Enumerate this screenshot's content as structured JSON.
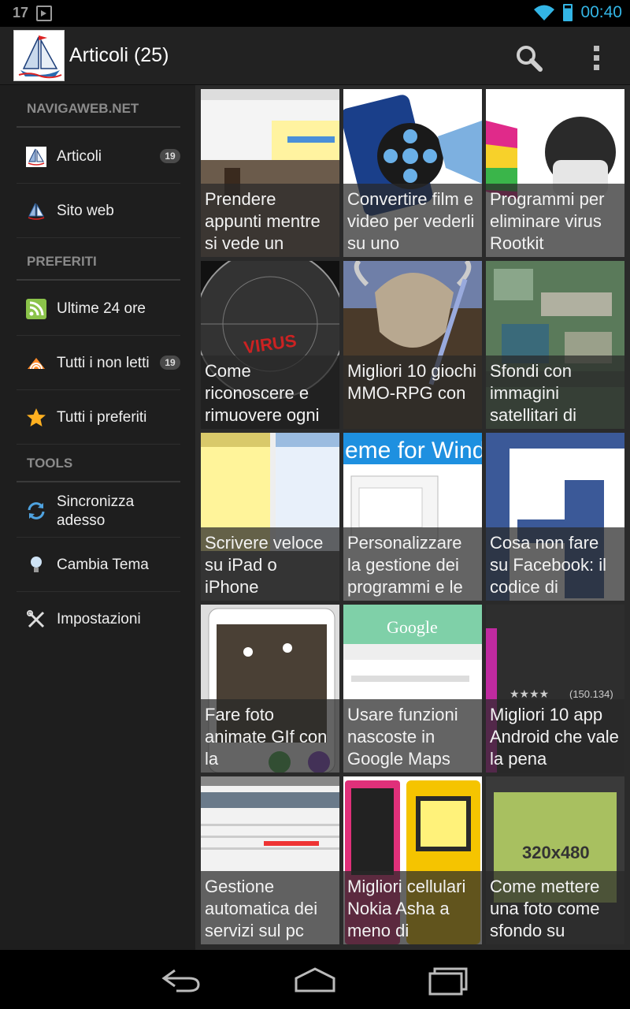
{
  "status_bar": {
    "left_text": "17",
    "time": "00:40",
    "accent": "#33b5e5"
  },
  "action_bar": {
    "title": "Articoli (25)",
    "search_icon": "search-icon",
    "overflow_icon": "overflow-menu-icon"
  },
  "drawer": {
    "sections": [
      {
        "header": "NAVIGAWEB.NET",
        "items": [
          {
            "label": "Articoli",
            "badge": "19",
            "icon": "sailboat-logo-icon"
          },
          {
            "label": "Sito web",
            "badge": "",
            "icon": "sailboat-icon"
          }
        ]
      },
      {
        "header": "PREFERITI",
        "items": [
          {
            "label": "Ultime 24 ore",
            "badge": "",
            "icon": "rss-icon"
          },
          {
            "label": "Tutti i non letti",
            "badge": "19",
            "icon": "unread-feed-icon"
          },
          {
            "label": "Tutti i preferiti",
            "badge": "",
            "icon": "star-icon"
          }
        ]
      },
      {
        "header": "TOOLS",
        "items": [
          {
            "label": "Sincronizza adesso",
            "badge": "",
            "icon": "sync-icon"
          },
          {
            "label": "Cambia Tema",
            "badge": "",
            "icon": "lightbulb-icon"
          },
          {
            "label": "Impostazioni",
            "badge": "",
            "icon": "settings-tools-icon"
          }
        ]
      }
    ]
  },
  "articles": [
    {
      "caption": "Prendere appunti mentre si vede un"
    },
    {
      "caption": "Convertire film e video per vederli su uno"
    },
    {
      "caption": "Programmi per eliminare virus Rootkit"
    },
    {
      "caption": "Come riconoscere e rimuovere ogni"
    },
    {
      "caption": "Migliori 10 giochi MMO-RPG con"
    },
    {
      "caption": "Sfondi con immagini satellitari di"
    },
    {
      "caption": "Scrivere veloce su iPad o iPhone"
    },
    {
      "caption": "Personalizzare la gestione dei programmi e le"
    },
    {
      "caption": "Cosa non fare su Facebook: il codice di"
    },
    {
      "caption": "Fare foto animate GIf con la"
    },
    {
      "caption": "Usare funzioni nascoste in Google Maps"
    },
    {
      "caption": "Migliori 10 app Android che vale la pena"
    },
    {
      "caption": "Gestione automatica dei servizi sul pc"
    },
    {
      "caption": "Migliori cellulari Nokia Asha a meno di"
    },
    {
      "caption": "Come mettere una foto come sfondo su"
    }
  ],
  "thumb_texts": {
    "virus": "VIRUS",
    "google": "Google",
    "resolution": "320x480",
    "rating": "(150.134)",
    "windows": "eme for Windo"
  },
  "nav_bar": {
    "back": "back-icon",
    "home": "home-icon",
    "recents": "recents-icon"
  }
}
